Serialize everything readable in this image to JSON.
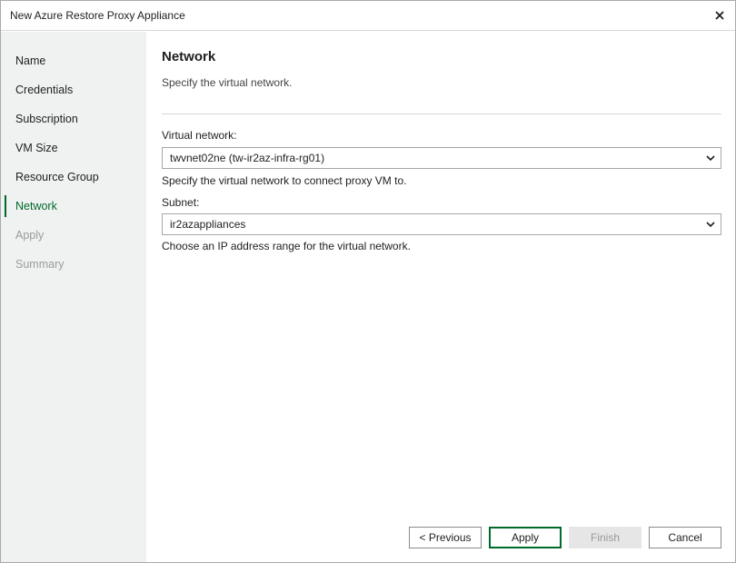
{
  "window": {
    "title": "New Azure Restore Proxy Appliance",
    "close_icon": "close-icon"
  },
  "sidebar": {
    "items": [
      {
        "label": "Name",
        "state": "normal"
      },
      {
        "label": "Credentials",
        "state": "normal"
      },
      {
        "label": "Subscription",
        "state": "normal"
      },
      {
        "label": "VM Size",
        "state": "normal"
      },
      {
        "label": "Resource Group",
        "state": "normal"
      },
      {
        "label": "Network",
        "state": "active"
      },
      {
        "label": "Apply",
        "state": "disabled"
      },
      {
        "label": "Summary",
        "state": "disabled"
      }
    ]
  },
  "main": {
    "title": "Network",
    "subtitle": "Specify the virtual network.",
    "virtual_network": {
      "label": "Virtual network:",
      "value": "twvnet02ne (tw-ir2az-infra-rg01)",
      "hint": "Specify the virtual network to connect proxy VM to."
    },
    "subnet": {
      "label": "Subnet:",
      "value": "ir2azappliances",
      "hint": "Choose an IP address range for the virtual network."
    }
  },
  "buttons": {
    "previous": "< Previous",
    "apply": "Apply",
    "finish": "Finish",
    "cancel": "Cancel"
  },
  "colors": {
    "accent": "#00692c",
    "sidebar_bg": "#f0f2f1",
    "disabled_text": "#9a9a9a"
  }
}
